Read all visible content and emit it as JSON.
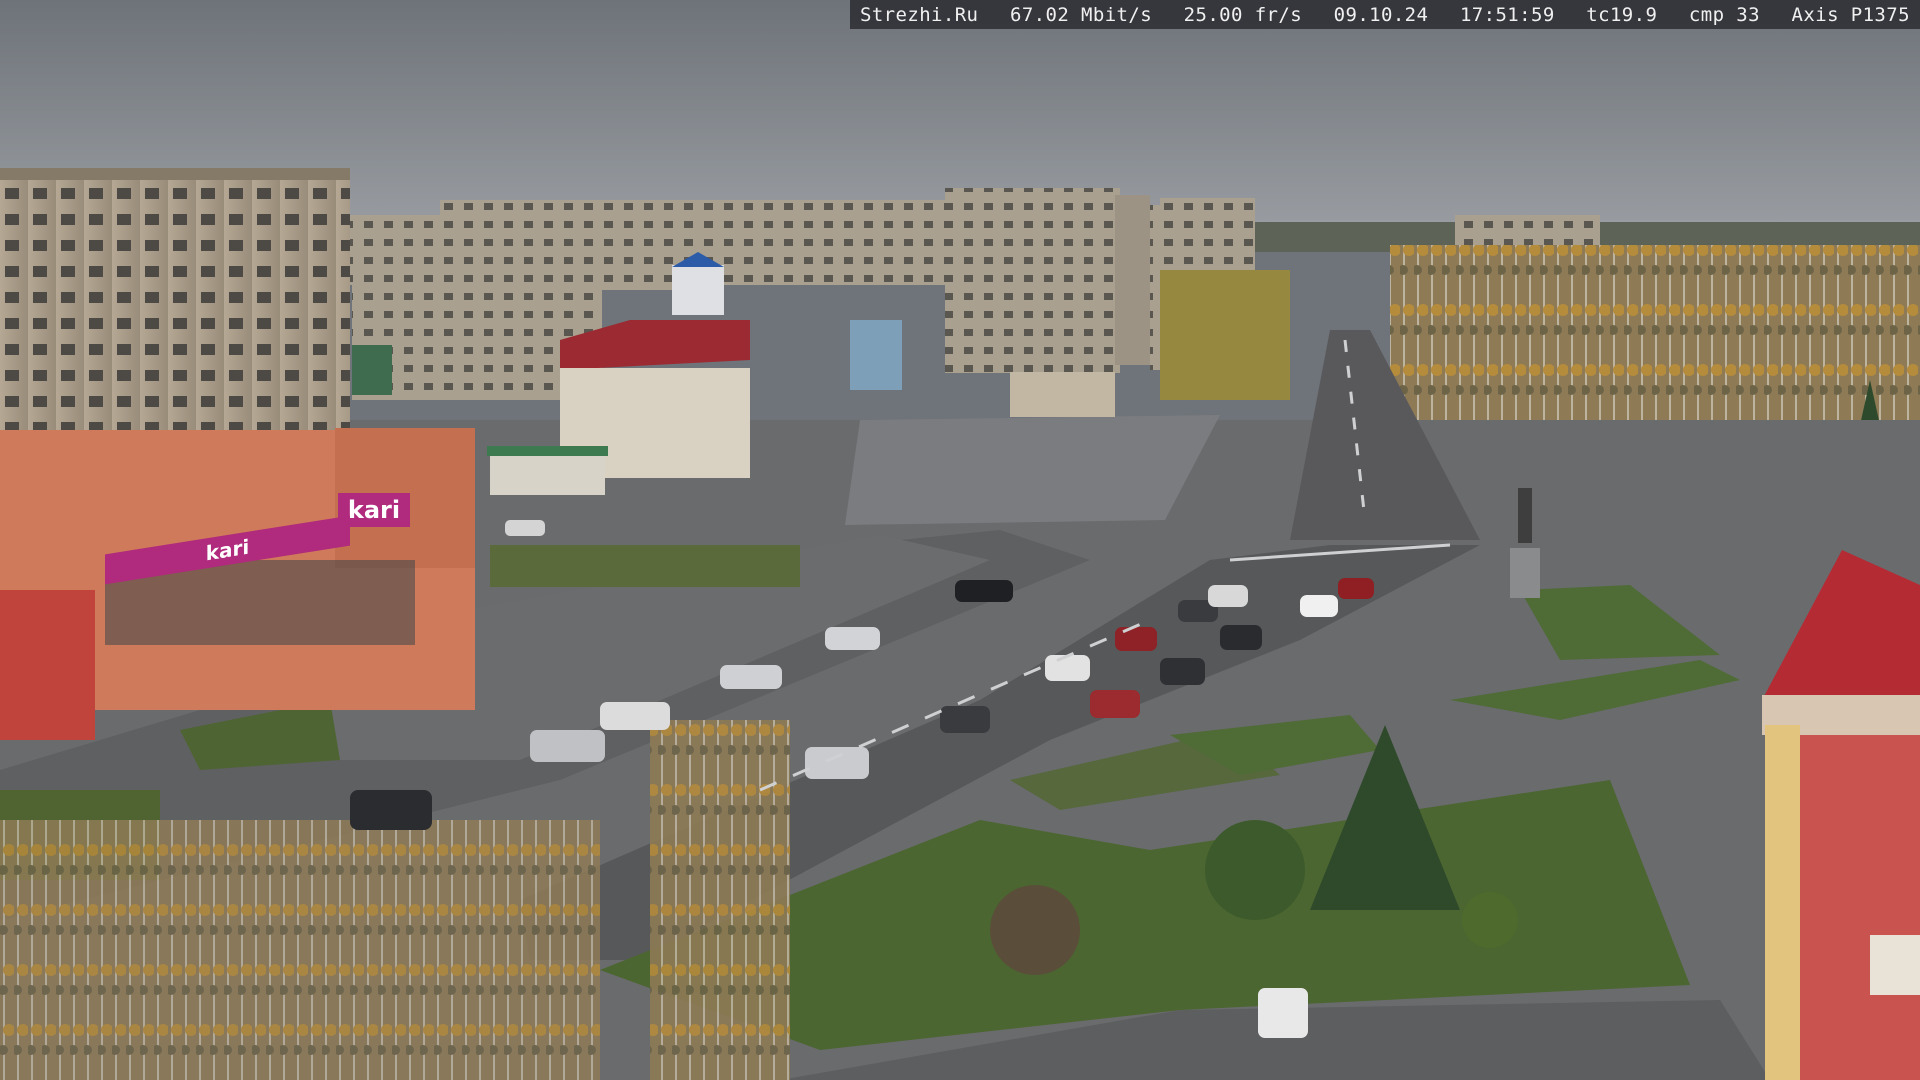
{
  "overlay": {
    "site": "Strezhi.Ru",
    "bitrate": "67.02 Mbit/s",
    "framerate": "25.00 fr/s",
    "date": "09.10.24",
    "time": "17:51:59",
    "tc": "tc19.9",
    "cmp": "cmp 33",
    "camera": "Axis P1375"
  },
  "storefront": {
    "brand": "kari",
    "brand_lower": "kari"
  },
  "colors": {
    "sky": "#7e8389",
    "road": "#5a5b5e",
    "grass": "#4f6b36",
    "brand": "#b02a7d",
    "roof_red": "#b52b34"
  }
}
